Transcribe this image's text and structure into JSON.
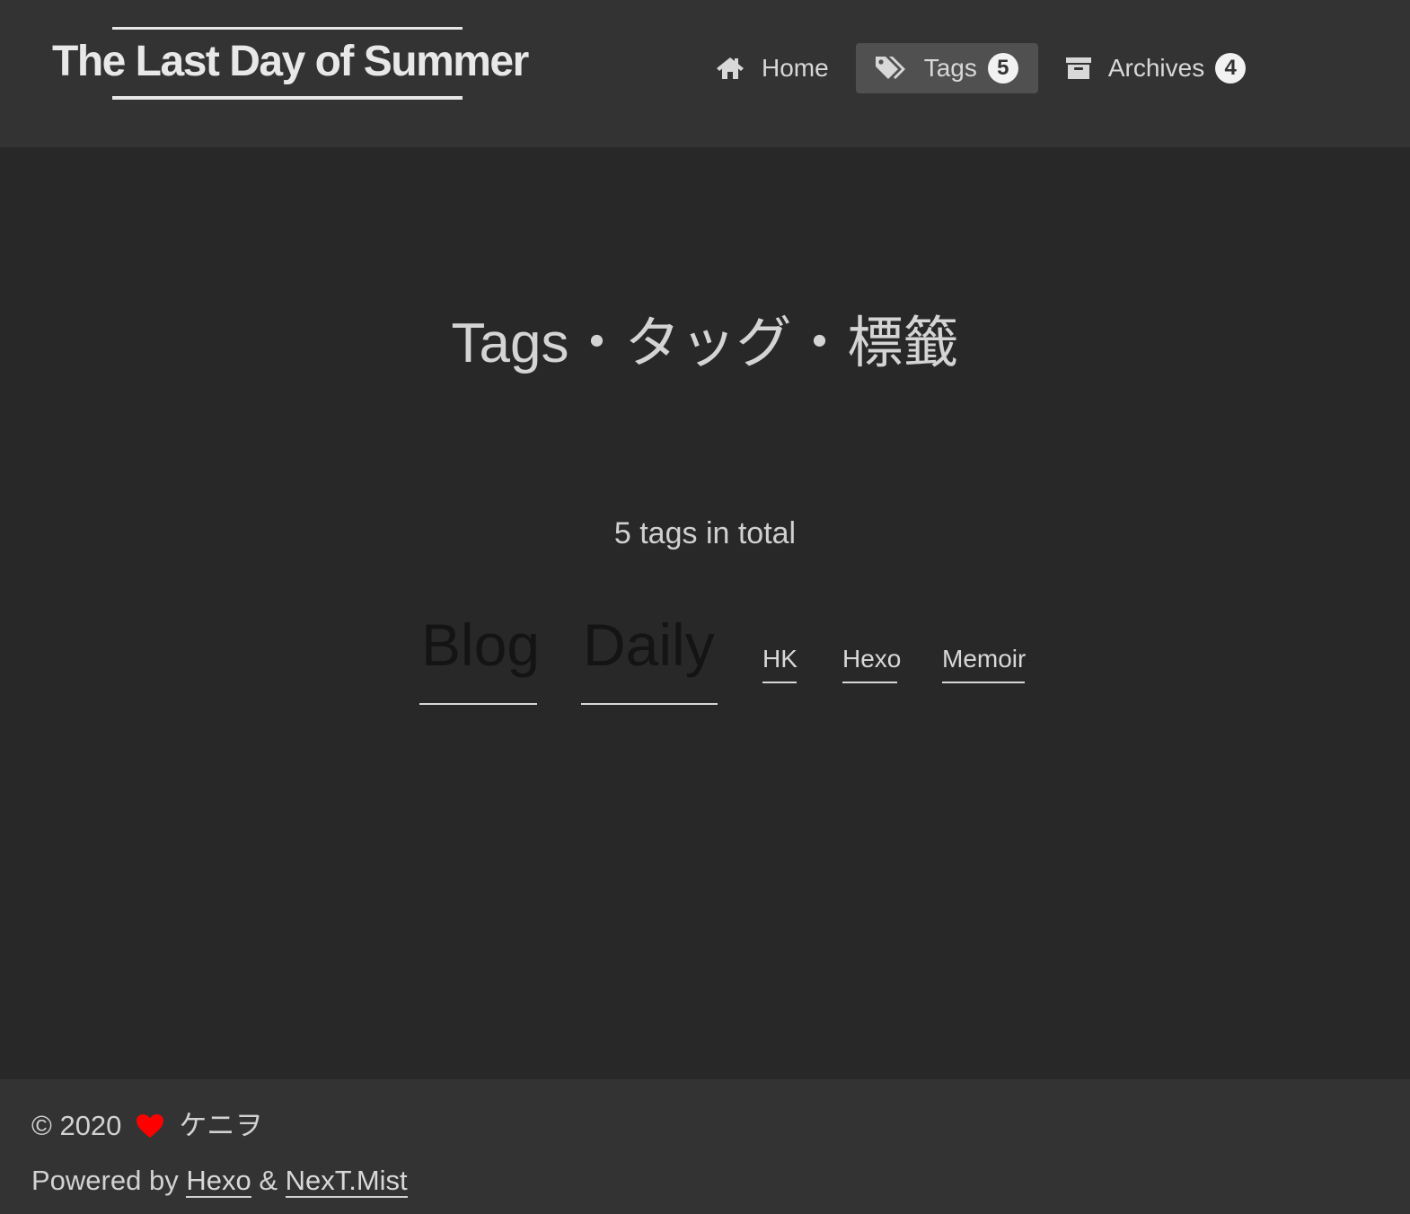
{
  "header": {
    "site_title": "The Last Day of Summer",
    "nav": {
      "home": {
        "label": "Home",
        "icon": "home-icon"
      },
      "tags": {
        "label": "Tags",
        "badge": "5",
        "icon": "tags-icon"
      },
      "archives": {
        "label": "Archives",
        "badge": "4",
        "icon": "archive-icon"
      }
    }
  },
  "main": {
    "title": "Tags・タッグ・標籤",
    "total": "5 tags in total",
    "tags": [
      "Blog",
      "Daily",
      "HK",
      "Hexo",
      "Memoir"
    ]
  },
  "footer": {
    "copyright_year": "© 2020",
    "heart_icon": "heart-icon",
    "heart_color": "#ff0000",
    "author": "ケニヲ",
    "powered_prefix": "Powered by ",
    "powered_hexo": "Hexo",
    "powered_sep": " & ",
    "powered_theme": "NexT.Mist"
  },
  "colors": {
    "header_bg": "#333333",
    "page_bg": "#282828",
    "active_nav_bg": "#505050"
  }
}
